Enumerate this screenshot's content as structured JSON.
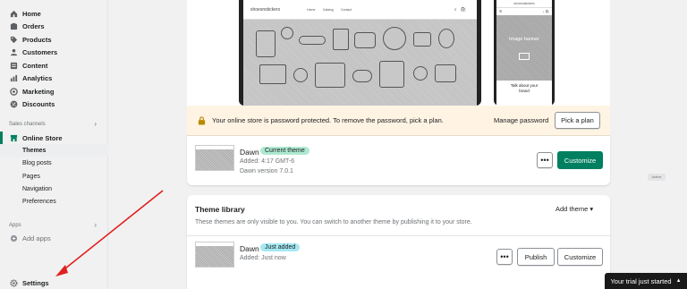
{
  "nav": {
    "items": [
      {
        "label": "Home",
        "icon": "home-icon"
      },
      {
        "label": "Orders",
        "icon": "orders-icon"
      },
      {
        "label": "Products",
        "icon": "tag-icon"
      },
      {
        "label": "Customers",
        "icon": "person-icon"
      },
      {
        "label": "Content",
        "icon": "content-icon"
      },
      {
        "label": "Analytics",
        "icon": "analytics-icon"
      },
      {
        "label": "Marketing",
        "icon": "marketing-icon"
      },
      {
        "label": "Discounts",
        "icon": "discount-icon"
      }
    ],
    "sales_channels_label": "Sales channels",
    "online_store": {
      "label": "Online Store",
      "icon": "store-icon"
    },
    "online_store_sub": [
      "Themes",
      "Blog posts",
      "Pages",
      "Navigation",
      "Preferences"
    ],
    "apps_label": "Apps",
    "add_apps": "Add apps",
    "settings": "Settings"
  },
  "preview": {
    "store_brand": "shoesnstickers",
    "menu": [
      "Home",
      "Catalog",
      "Contact"
    ],
    "mobile_header": "shoesnstickers",
    "banner_title": "Image banner",
    "talk_line1": "Talk about your",
    "talk_line2": "brand"
  },
  "password_banner": {
    "text": "Your online store is password protected. To remove the password, pick a plan.",
    "manage": "Manage password",
    "pick": "Pick a plan"
  },
  "current_theme": {
    "name": "Dawn",
    "badge": "Current theme",
    "added": "Added: 4:17 GMT-6",
    "version": "Dawn version 7.0.1",
    "more": "•••",
    "customize": "Customize"
  },
  "aside_badge": "Active",
  "library": {
    "title": "Theme library",
    "description": "These themes are only visible to you. You can switch to another theme by publishing it to your store.",
    "add_theme": "Add theme",
    "theme": {
      "name": "Dawn",
      "badge": "Just added",
      "added": "Added: Just now",
      "more": "•••",
      "publish": "Publish",
      "customize": "Customize"
    }
  },
  "trial": "Your trial just started",
  "colors": {
    "brand_green": "#008060",
    "arrow_red": "#e02020",
    "banner_bg": "#fff4e4"
  }
}
